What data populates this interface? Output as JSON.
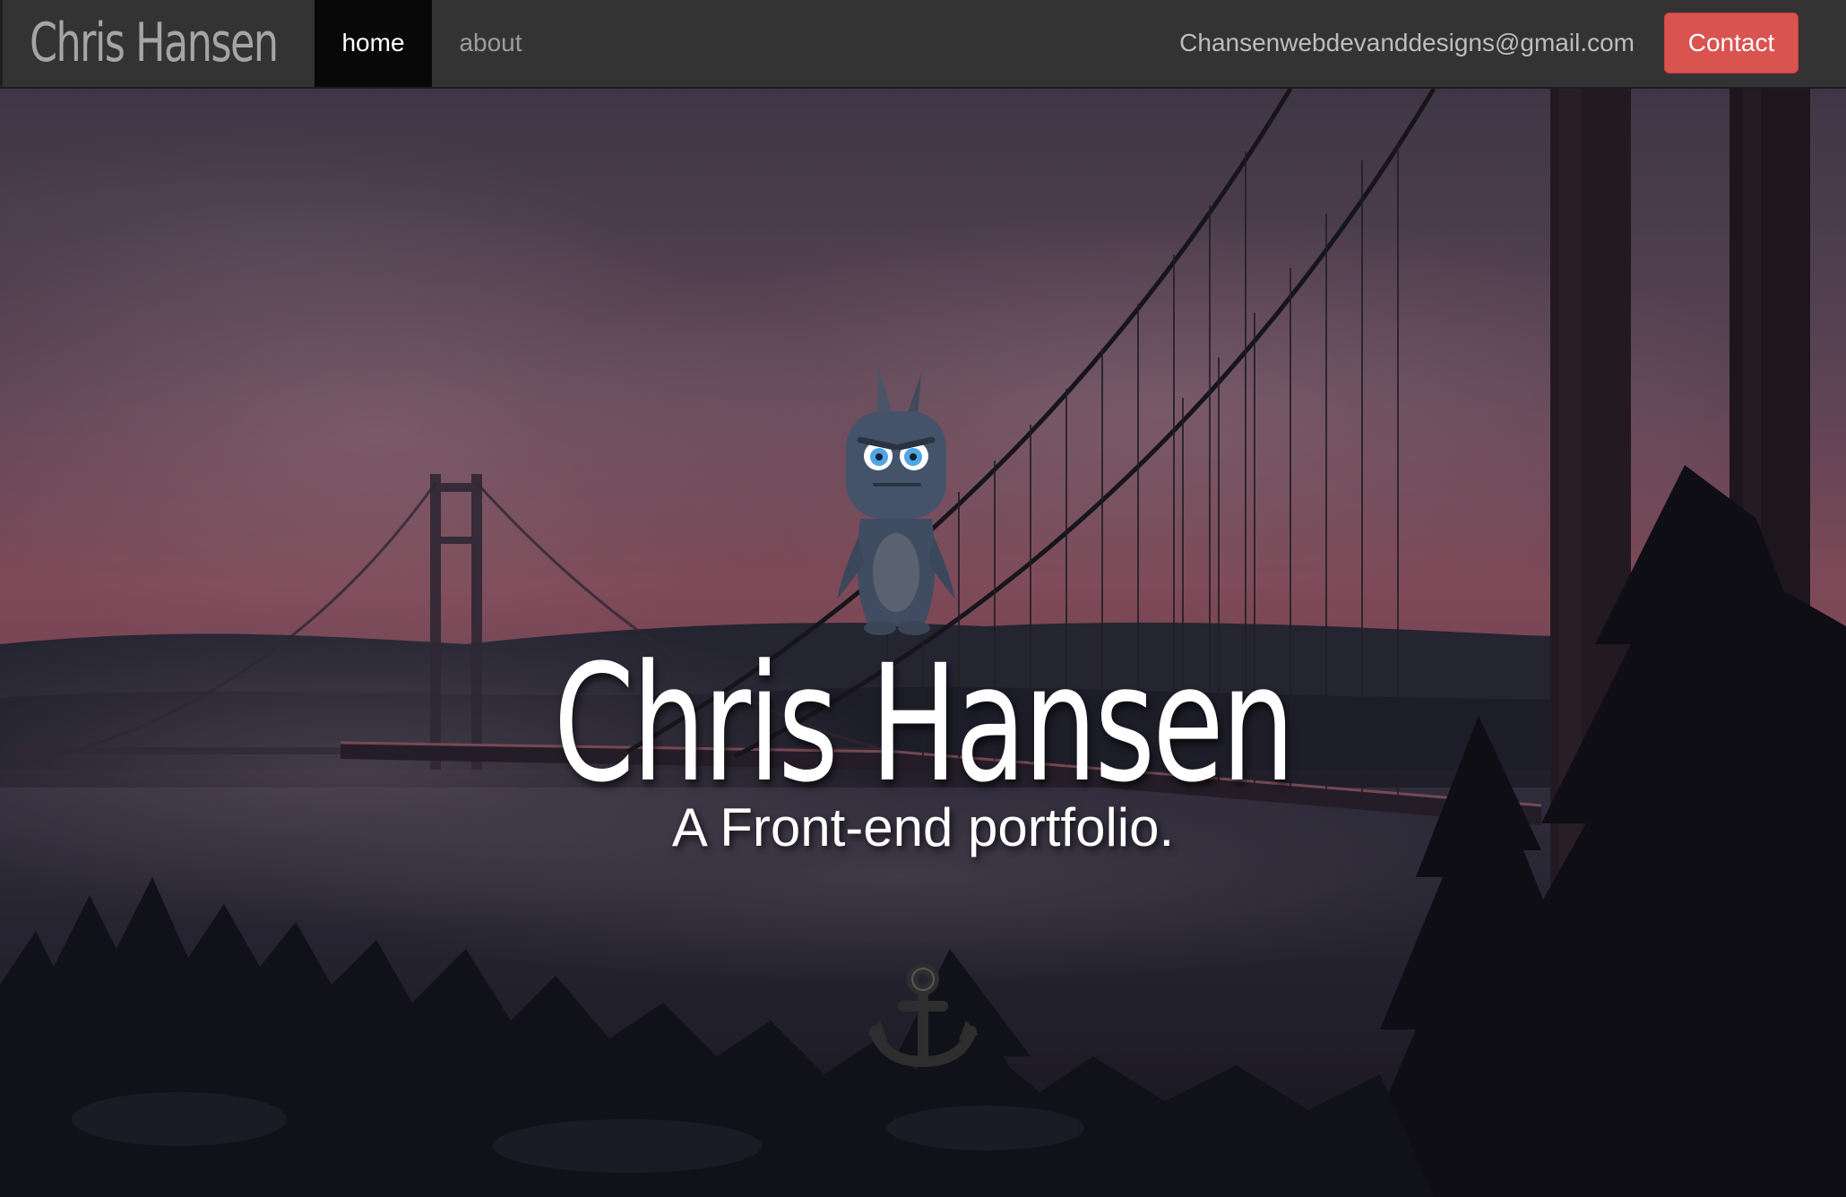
{
  "navbar": {
    "brand": "Chris Hansen",
    "items": [
      {
        "label": "home",
        "active": true
      },
      {
        "label": "about",
        "active": false
      }
    ],
    "email": "Chansenwebdevanddesigns@gmail.com",
    "contact_label": "Contact"
  },
  "hero": {
    "title": "Chris Hansen",
    "subtitle": "A Front-end portfolio.",
    "mascot_icon": "monster-mascot-icon",
    "scroll_icon": "anchor-icon",
    "background": "foggy-suspension-bridge-sunset-photo"
  },
  "colors": {
    "navbar_bg": "#333333",
    "nav_active_bg": "#080808",
    "contact_button": "#d9534f",
    "sky_top": "#5b4a63",
    "sky_mid": "#a05a6c",
    "forest": "#14161f"
  }
}
